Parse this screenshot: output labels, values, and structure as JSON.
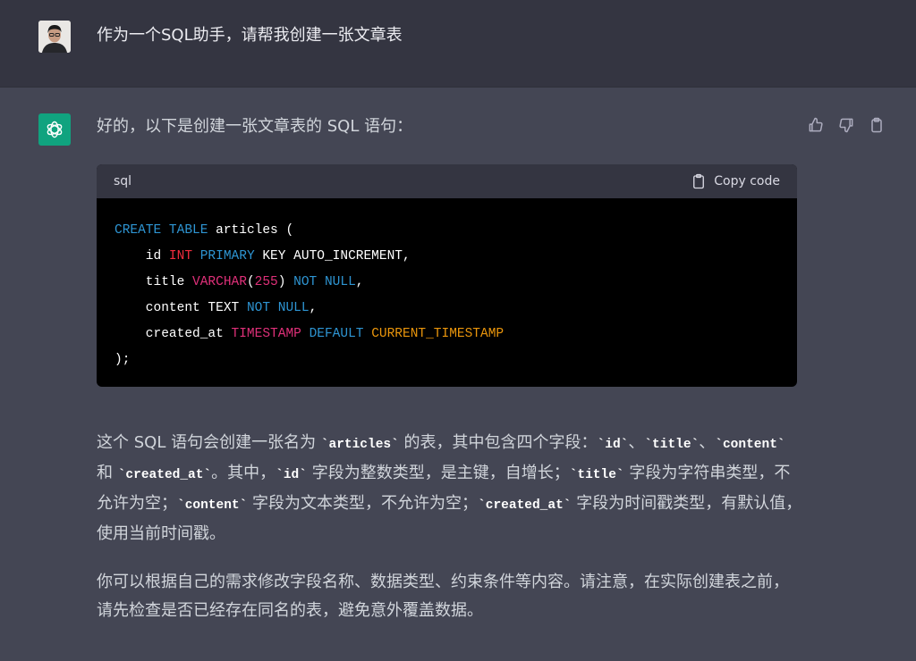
{
  "user": {
    "message": "作为一个SQL助手，请帮我创建一张文章表"
  },
  "assistant": {
    "intro": "好的，以下是创建一张文章表的 SQL 语句：",
    "code": {
      "language": "sql",
      "copy_label": "Copy code",
      "lines": [
        [
          {
            "t": "CREATE",
            "c": "blue"
          },
          {
            "t": " "
          },
          {
            "t": "TABLE",
            "c": "blue"
          },
          {
            "t": " articles ("
          }
        ],
        [
          {
            "t": "    id "
          },
          {
            "t": "INT",
            "c": "red"
          },
          {
            "t": " "
          },
          {
            "t": "PRIMARY",
            "c": "blue"
          },
          {
            "t": " KEY AUTO_INCREMENT,"
          }
        ],
        [
          {
            "t": "    title "
          },
          {
            "t": "VARCHAR",
            "c": "pink"
          },
          {
            "t": "("
          },
          {
            "t": "255",
            "c": "pink"
          },
          {
            "t": ") "
          },
          {
            "t": "NOT",
            "c": "blue"
          },
          {
            "t": " "
          },
          {
            "t": "NULL",
            "c": "blue"
          },
          {
            "t": ","
          }
        ],
        [
          {
            "t": "    content TEXT "
          },
          {
            "t": "NOT",
            "c": "blue"
          },
          {
            "t": " "
          },
          {
            "t": "NULL",
            "c": "blue"
          },
          {
            "t": ","
          }
        ],
        [
          {
            "t": "    created_at "
          },
          {
            "t": "TIMESTAMP",
            "c": "pink"
          },
          {
            "t": " "
          },
          {
            "t": "DEFAULT",
            "c": "blue"
          },
          {
            "t": " "
          },
          {
            "t": "CURRENT_TIMESTAMP",
            "c": "orange"
          }
        ],
        [
          {
            "t": ");"
          }
        ]
      ]
    },
    "paragraph1": [
      {
        "t": "这个 SQL 语句会创建一张名为 "
      },
      {
        "code": "`articles`"
      },
      {
        "t": " 的表，其中包含四个字段："
      },
      {
        "code": "`id`"
      },
      {
        "t": "、"
      },
      {
        "code": "`title`"
      },
      {
        "t": "、"
      },
      {
        "code": "`content`"
      },
      {
        "t": " 和 "
      },
      {
        "code": "`created_at`"
      },
      {
        "t": "。其中，"
      },
      {
        "code": "`id`"
      },
      {
        "t": " 字段为整数类型，是主键，自增长；"
      },
      {
        "code": "`title`"
      },
      {
        "t": " 字段为字符串类型，不允许为空；"
      },
      {
        "code": "`content`"
      },
      {
        "t": " 字段为文本类型，不允许为空；"
      },
      {
        "code": "`created_at`"
      },
      {
        "t": " 字段为时间戳类型，有默认值，使用当前时间戳。"
      }
    ],
    "paragraph2": "你可以根据自己的需求修改字段名称、数据类型、约束条件等内容。请注意，在实际创建表之前，请先检查是否已经存在同名的表，避免意外覆盖数据。"
  },
  "colors": {
    "blue": "#2e95d3",
    "red": "#f22c3d",
    "pink": "#df3079",
    "orange": "#e9950c",
    "brand": "#10a37f"
  },
  "icons": [
    "user-avatar",
    "openai-logo-icon",
    "thumbs-up-icon",
    "thumbs-down-icon",
    "clipboard-icon"
  ]
}
